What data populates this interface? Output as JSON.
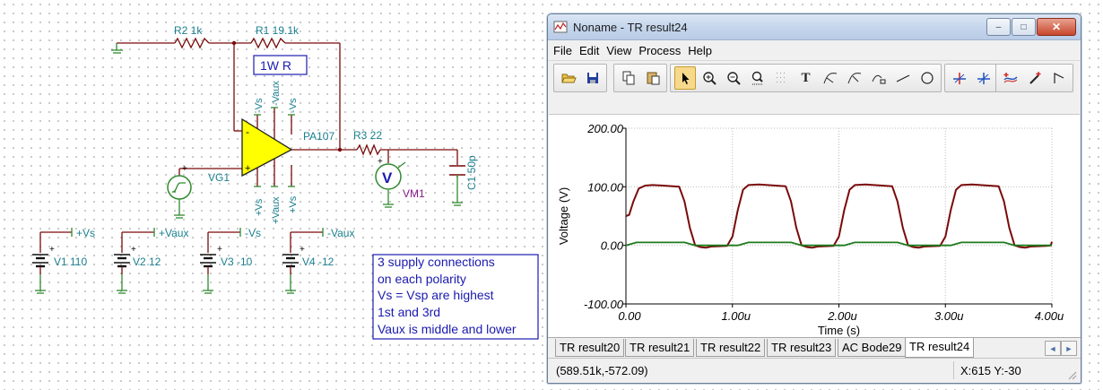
{
  "schematic": {
    "r2_label": "R2 1k",
    "r1_label": "R1 19.1k",
    "r1_power_box": "1W R",
    "opamp_label": "PA107",
    "top_pin_1": "-Vs",
    "top_pin_2": "-Vaux",
    "top_pin_3": "-Vs",
    "bottom_pin_1": "+Vs",
    "bottom_pin_2": "+Vaux",
    "bottom_pin_3": "+Vs",
    "r3_label": "R3 22",
    "c1_label": "C1 50p",
    "vg_label": "VG1",
    "vm_label": "VM1",
    "vm_symbol": "V",
    "minus_sign": "-",
    "plus_sign": "+",
    "supplies": [
      {
        "net": "+Vs",
        "label": "V1 110"
      },
      {
        "net": "+Vaux",
        "label": "V2 12"
      },
      {
        "net": "-Vs",
        "label": "V3 -10"
      },
      {
        "net": "-Vaux",
        "label": "V4 -12"
      }
    ],
    "note_lines": [
      "3 supply connections",
      "on each polarity",
      "Vs = Vsp are highest",
      "1st and 3rd",
      "Vaux is middle and lower"
    ]
  },
  "window": {
    "title": "Noname - TR result24",
    "buttons": {
      "minimize": "–",
      "maximize": "□",
      "close": "✕"
    },
    "menu": [
      "File",
      "Edit",
      "View",
      "Process",
      "Help"
    ],
    "toolbar_icons": [
      "open-folder-icon",
      "save-icon",
      "copy-icon",
      "paste-icon",
      "pointer-icon",
      "zoom-in-icon",
      "zoom-out-icon",
      "zoom-fit-icon",
      "grid-icon",
      "text-icon",
      "curve-label-icon",
      "curve-label-2-icon",
      "curve-marker-icon",
      "line-icon",
      "circle-icon",
      "cursor-a-icon",
      "cursor-b-icon",
      "curve-select-icon",
      "pen-icon",
      "flag-icon"
    ],
    "text_tool_glyph": "T",
    "active_tool": "pointer-icon",
    "colors": {
      "series_voltage": "#7a0a0a",
      "series_input": "#1d7a1d",
      "titlebar": "#c4d5ec"
    }
  },
  "chart_data": {
    "type": "line",
    "xlabel": "Time (s)",
    "ylabel": "Voltage (V)",
    "xlim": [
      0,
      4.0
    ],
    "ylim": [
      -100,
      200
    ],
    "x_ticks": [
      "0.00",
      "1.00u",
      "2.00u",
      "3.00u",
      "4.00u"
    ],
    "y_ticks": [
      "200.00",
      "100.00",
      "0.00",
      "-100.00"
    ],
    "grid": true,
    "x_unit": "us",
    "series": [
      {
        "color": "#7a0a0a",
        "x": [
          0,
          0.03,
          0.07,
          0.12,
          0.18,
          0.25,
          0.35,
          0.5,
          0.55,
          0.6,
          0.65,
          0.7,
          0.75,
          0.8,
          0.95,
          1.0,
          1.05,
          1.1,
          1.15,
          1.25,
          1.5,
          1.55,
          1.6,
          1.65,
          1.7,
          1.75,
          1.8,
          1.95,
          2.0,
          2.05,
          2.1,
          2.15,
          2.25,
          2.5,
          2.55,
          2.6,
          2.65,
          2.7,
          2.75,
          2.8,
          2.95,
          3.0,
          3.05,
          3.1,
          3.15,
          3.25,
          3.5,
          3.55,
          3.6,
          3.65,
          3.7,
          3.75,
          3.8,
          3.95,
          3.99,
          4.0
        ],
        "y": [
          50,
          52,
          75,
          97,
          102,
          103,
          102,
          100,
          75,
          30,
          0,
          -3,
          -4,
          -2,
          -1,
          15,
          60,
          95,
          103,
          104,
          101,
          75,
          30,
          0,
          -3,
          -4,
          -2,
          -1,
          15,
          60,
          95,
          103,
          104,
          101,
          75,
          30,
          0,
          -3,
          -4,
          -2,
          -1,
          15,
          60,
          95,
          103,
          104,
          101,
          75,
          30,
          0,
          -3,
          -4,
          -2,
          -1,
          0,
          6
        ]
      },
      {
        "color": "#1d7a1d",
        "x": [
          0,
          0.1,
          0.55,
          0.65,
          1.05,
          1.15,
          1.55,
          1.65,
          2.05,
          2.15,
          2.55,
          2.65,
          3.05,
          3.15,
          3.55,
          3.65,
          4.0
        ],
        "y": [
          0,
          5,
          5,
          0,
          0,
          5,
          5,
          0,
          0,
          5,
          5,
          0,
          0,
          5,
          5,
          0,
          0
        ]
      }
    ]
  },
  "tabs": [
    {
      "label": "TR result20",
      "active": false
    },
    {
      "label": "TR result21",
      "active": false
    },
    {
      "label": "TR result22",
      "active": false
    },
    {
      "label": "TR result23",
      "active": false
    },
    {
      "label": "AC Bode29",
      "active": false
    },
    {
      "label": "TR result24",
      "active": true
    }
  ],
  "tab_arrows": {
    "left": "◄",
    "right": "►"
  },
  "status": {
    "coords": "(589.51k,-572.09)",
    "cursor": "X:615  Y:-30"
  }
}
